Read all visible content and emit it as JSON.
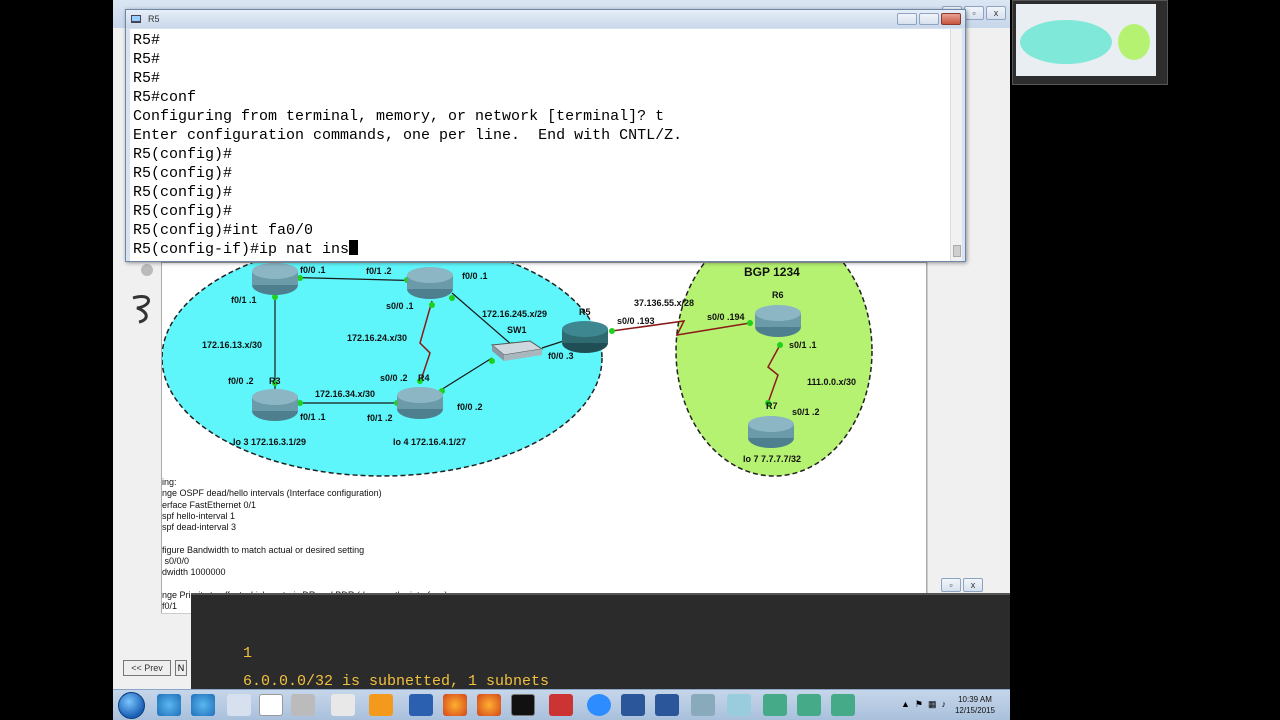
{
  "terminal": {
    "title": "R5",
    "lines": [
      "R5#",
      "R5#",
      "R5#",
      "R5#conf",
      "Configuring from terminal, memory, or network [terminal]? t",
      "Enter configuration commands, one per line.  End with CNTL/Z.",
      "R5(config)#",
      "R5(config)#",
      "R5(config)#",
      "R5(config)#",
      "R5(config)#int fa0/0"
    ],
    "current_line": "R5(config-if)#ip nat ins"
  },
  "topology": {
    "bgp_label": "BGP 1234",
    "links": {
      "r1_r2_left": "f0/0  .1",
      "r1_r2_right": "f0/1  .2",
      "r2_f00": "f0/0  .1",
      "r2_s00": "s0/0  .1",
      "r1_f01": "f0/1  .1",
      "r1_r3_net": "172.16.13.x/30",
      "r2_r4_net": "172.16.24.x/30",
      "sw_net": "172.16.245.x/29",
      "sw_label": "SW1",
      "r5_label": "R5",
      "r5_s00": "s0/0  .193",
      "r5_f00": "f0/0  .3",
      "r5_r6_net": "37.136.55.x/28",
      "r6_label": "R6",
      "r6_s00": "s0/0  .194",
      "r6_s01": "s0/1  .1",
      "r6_r7_net": "111.0.0.x/30",
      "r7_label": "R7",
      "r7_s01": "s0/1  .2",
      "r7_lo": "lo 7  7.7.7.7/32",
      "r3_f00": "f0/0  .2",
      "r3_label": "R3",
      "r3_r4_net": "172.16.34.x/30",
      "r4_s00": "s0/0  .2",
      "r4_label": "R4",
      "r4_f00": "f0/0  .2",
      "r3_f01": "f0/1  .1",
      "r4_f01": "f0/1  .2",
      "r3_lo": "lo 3  172.16.3.1/29",
      "r4_lo": "lo 4  172.16.4.1/27"
    }
  },
  "notes": [
    "ing:",
    "nge OSPF dead/hello intervals (Interface configuration)",
    "erface FastEthernet 0/1",
    "spf hello-interval 1",
    "spf dead-interval 3",
    "",
    "figure Bandwidth to match actual or desired setting",
    " s0/0/0",
    "dwidth 1000000",
    "",
    "nge Priority to affect which routeris DR and BDR (done on the interface)",
    "f0/1"
  ],
  "nav": {
    "prev": "<< Prev",
    "next": "N"
  },
  "console2": {
    "prev_line": "1",
    "line": "6.0.0.0/32 is subnetted, 1 subnets"
  },
  "clock": {
    "time": "10:39 AM",
    "date": "12/15/2015"
  },
  "colors": {
    "ospf_area": "#5ef6fb",
    "bgp_area": "#b6f271",
    "link": "#8b1a1a",
    "router": "#5a8a9a"
  }
}
